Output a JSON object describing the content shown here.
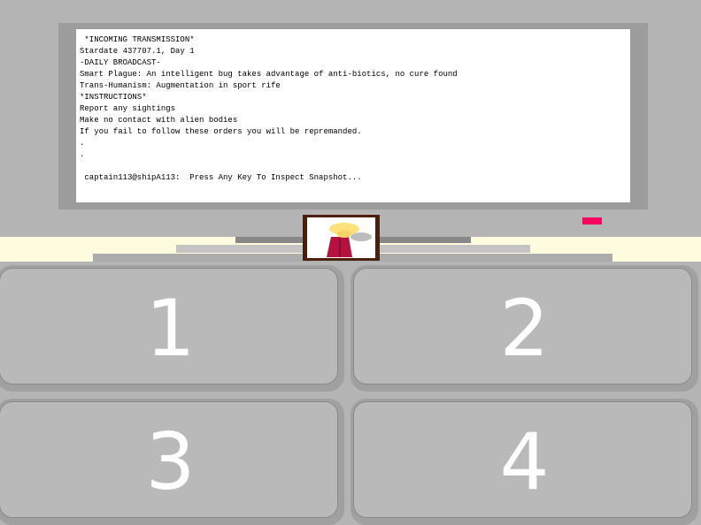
{
  "transmission": {
    "lines": [
      " *INCOMING TRANSMISSION*",
      "Stardate 437707.1, Day 1",
      "-DAILY BROADCAST-",
      "Smart Plague: An intelligent bug takes advantage of anti-biotics, no cure found",
      "Trans-Humanism: Augmentation in sport rife",
      "*INSTRUCTIONS*",
      "Report any sightings",
      "Make no contact with alien bodies",
      "If you fail to follow these orders you will be repremanded.",
      ".",
      ".",
      "",
      " captain113@shipA113:  Press Any Key To Inspect Snapshot..."
    ]
  },
  "keypad": {
    "key1": "1",
    "key2": "2",
    "key3": "3",
    "key4": "4"
  },
  "colors": {
    "indicator": "#ff0060",
    "snapshot_frame": "#4a1f0d",
    "figure_body": "#b5123f",
    "figure_head": "#ffe07a"
  },
  "icons": {
    "snapshot": "alien-figure-snapshot"
  }
}
